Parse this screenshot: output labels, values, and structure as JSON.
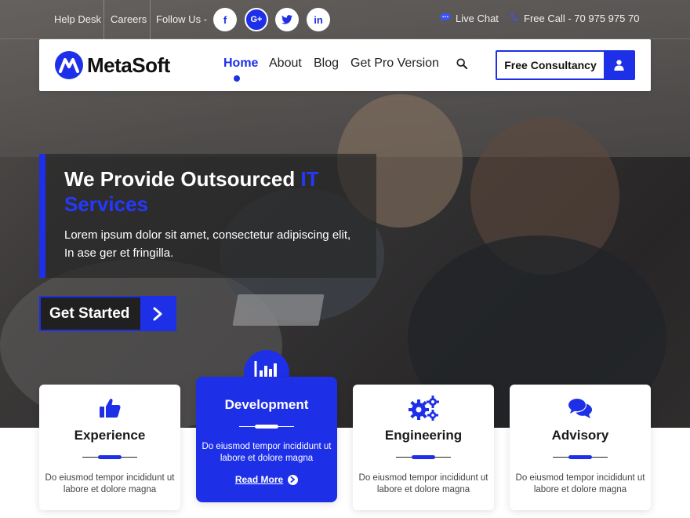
{
  "topbar": {
    "help_desk": "Help Desk",
    "careers": "Careers",
    "follow_us": "Follow Us -",
    "social": {
      "facebook": "f",
      "google_plus": "G+",
      "twitter": "t",
      "linkedin": "in"
    },
    "live_chat": "Live Chat",
    "free_call": "Free Call - 70 975 975 70"
  },
  "navbar": {
    "logo_text": "MetaSoft",
    "items": [
      {
        "label": "Home"
      },
      {
        "label": "About"
      },
      {
        "label": "Blog"
      },
      {
        "label": "Get Pro Version"
      }
    ],
    "consult_label": "Free Consultancy"
  },
  "hero": {
    "title_main": "We Provide Outsourced ",
    "title_accent": "IT Services",
    "subtitle": "Lorem ipsum dolor sit amet, consectetur adipiscing elit, In ase ger et fringilla.",
    "cta_label": "Get Started"
  },
  "services": [
    {
      "title": "Experience",
      "text": "Do eiusmod tempor incididunt ut labore et dolore magna",
      "icon": "thumbs-up-icon"
    },
    {
      "title": "Development",
      "text": "Do eiusmod tempor incididunt ut labore et dolore magna",
      "icon": "bar-chart-icon",
      "read_more": "Read More"
    },
    {
      "title": "Engineering",
      "text": "Do eiusmod tempor incididunt ut labore et dolore magna",
      "icon": "gears-icon"
    },
    {
      "title": "Advisory",
      "text": "Do eiusmod tempor incididunt ut labore et dolore magna",
      "icon": "comments-icon"
    }
  ],
  "colors": {
    "accent": "#1e2fe8",
    "text_dark": "#1a1a1a",
    "white": "#ffffff"
  }
}
